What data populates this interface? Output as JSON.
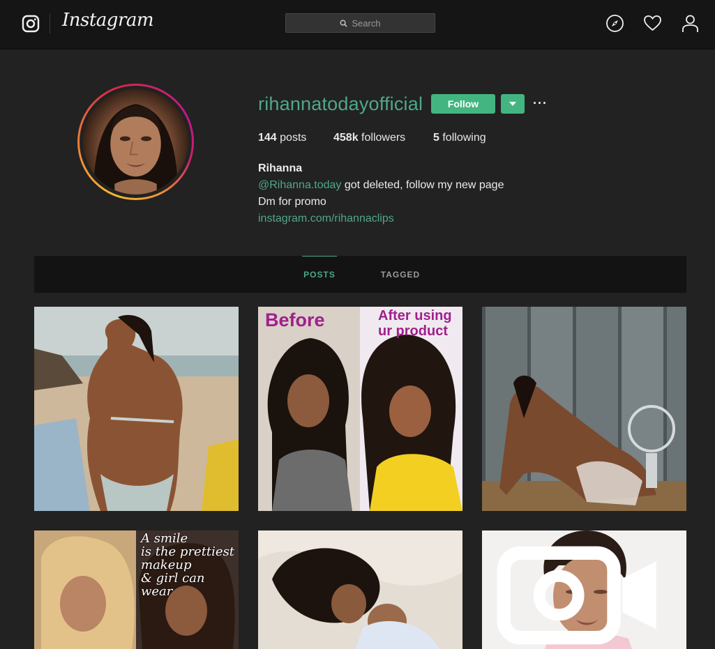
{
  "nav": {
    "wordmark": "Instagram",
    "search_placeholder": "Search",
    "icons": [
      "instagram-logo-icon",
      "explore-compass-icon",
      "heart-activity-icon",
      "profile-user-icon"
    ]
  },
  "profile": {
    "username": "rihannatodayofficial",
    "follow_label": "Follow",
    "stats": {
      "posts_count": "144",
      "posts_label": "posts",
      "followers_count": "458k",
      "followers_label": "followers",
      "following_count": "5",
      "following_label": "following"
    },
    "bio": {
      "name": "Rihanna",
      "mention": "@Rihanna.today",
      "line1_rest": " got deleted, follow my new page",
      "line2": "Dm for promo",
      "link": "instagram.com/rihannaclips"
    }
  },
  "tabs": [
    {
      "label": "POSTS",
      "active": true
    },
    {
      "label": "TAGGED",
      "active": false
    }
  ],
  "posts": {
    "p2_before": "Before",
    "p2_after": "After using\nur product",
    "p4_caption": "A smile\nis the prettiest\nmakeup\n& girl can wear"
  },
  "colors": {
    "accent": "#4ea889",
    "button": "#43b581",
    "background": "#222222",
    "nav": "#151515"
  }
}
